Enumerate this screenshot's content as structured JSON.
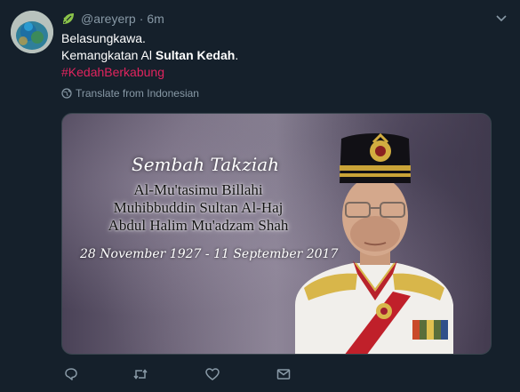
{
  "tweet": {
    "handle": "@areyerp",
    "separator": "·",
    "time": "6m",
    "lines": {
      "line1": "Belasungkawa.",
      "line2_prefix": "Kemangkatan Al ",
      "line2_bold": "Sultan Kedah",
      "line2_suffix": ".",
      "hashtag": "#KedahBerkabung"
    },
    "translate_label": "Translate from Indonesian"
  },
  "media": {
    "script_title": "Sembah Takziah",
    "name_lines": [
      "Al-Mu'tasimu Billahi",
      "Muhibbuddin Sultan Al-Haj",
      "Abdul Halim Mu'adzam Shah"
    ],
    "dates": "28 November 1927 - 11 September 2017"
  },
  "icons": {
    "avatar": "avatar-peacock",
    "leaf": "leaf-icon",
    "caret": "chevron-down-icon",
    "globe": "globe-icon",
    "reply": "reply-icon",
    "retweet": "retweet-icon",
    "like": "heart-icon",
    "dm": "envelope-icon"
  },
  "colors": {
    "background": "#15202b",
    "secondary_text": "#8899a6",
    "hashtag": "#e0245e",
    "leaf": "#8bc34a"
  }
}
